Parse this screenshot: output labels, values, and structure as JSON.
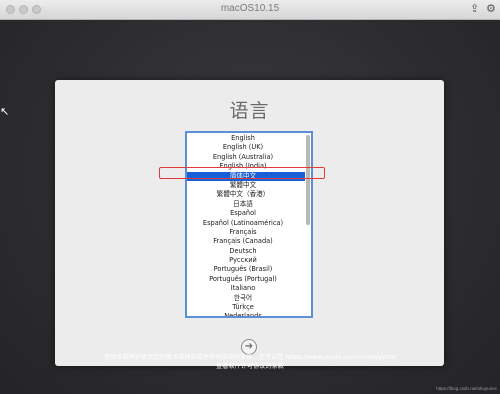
{
  "window": {
    "title": "macOS10.15"
  },
  "panel": {
    "heading": "语言",
    "languages": [
      "English",
      "English (UK)",
      "English (Australia)",
      "English (India)",
      "简体中文",
      "繁體中文",
      "繁體中文（香港）",
      "日本語",
      "Español",
      "Español (Latinoamérica)",
      "Français",
      "Français (Canada)",
      "Deutsch",
      "Русский",
      "Português (Brasil)",
      "Português (Portugal)",
      "Italiano",
      "한국어",
      "Türkçe",
      "Nederlands"
    ],
    "selected_index": 4,
    "next_arrow": "➔"
  },
  "footer": {
    "line1": "使用本软件即表示您同意本软件的软件许可协议的条款。您可以在 https://www.apple.com/cn/legal/sla/",
    "line2": "查看软件许可协议的条款"
  },
  "watermark": "https://blog.csdn.net/shuyunec",
  "icons": {
    "share": "⇪",
    "settings": "⚙",
    "cursor": "↖"
  },
  "colors": {
    "selection": "#1760d7",
    "list_border": "#5b8fd6",
    "highlight": "#e03c3c"
  }
}
